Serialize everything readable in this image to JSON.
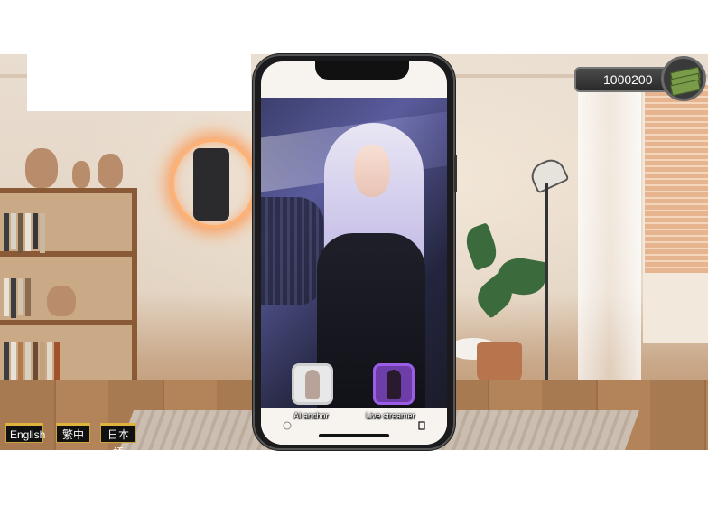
{
  "wallet": {
    "amount": "1000200",
    "icon": "cash-stack-icon"
  },
  "phone": {
    "status_time": "",
    "status_right": "",
    "tabs": [
      {
        "label": "AI anchor",
        "icon": "ai-anchor-avatar"
      },
      {
        "label": "Live streamer",
        "icon": "live-streamer-avatar"
      }
    ]
  },
  "languages": [
    {
      "label": "English"
    },
    {
      "label": "繁中"
    },
    {
      "label": "日本語"
    }
  ],
  "colors": {
    "accent_gold": "#e0b43c",
    "live_tab_purple": "#6e3ea8",
    "neon_orange": "#ffb170"
  }
}
